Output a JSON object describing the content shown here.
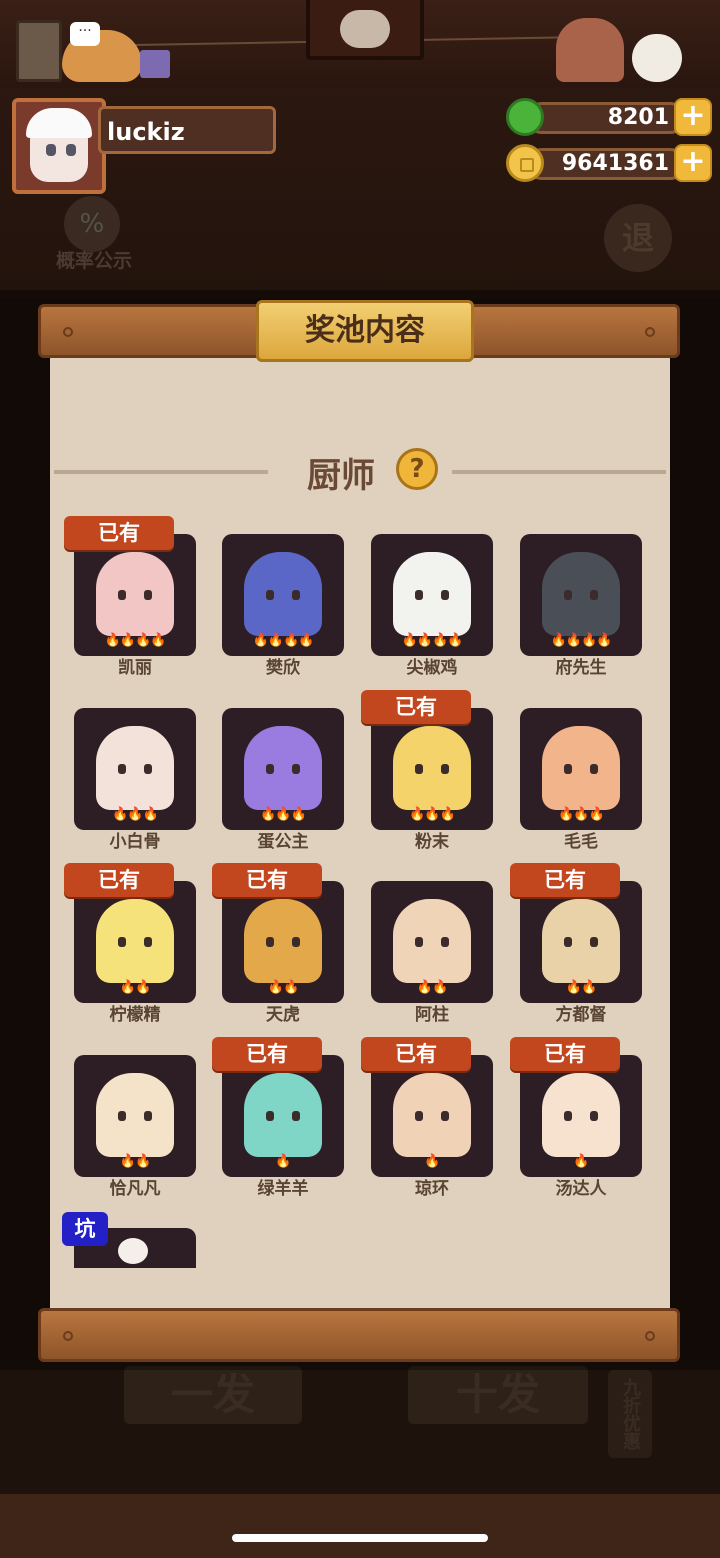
{
  "player": {
    "name": "luckiz"
  },
  "resources": {
    "apples": "8201",
    "coins": "9641361",
    "plus_label": "+"
  },
  "top_buttons": {
    "probability": "概率公示",
    "exit": "退"
  },
  "pool": {
    "title": "奖池内容",
    "section": "厨师",
    "help_label": "?",
    "owned_label": "已有",
    "pit_label": "坑",
    "chefs": [
      {
        "name": "凯丽",
        "owned": true,
        "stars": 4,
        "color": "#f1c6c4"
      },
      {
        "name": "樊欣",
        "owned": false,
        "stars": 4,
        "color": "#5b67c7"
      },
      {
        "name": "尖椒鸡",
        "owned": false,
        "stars": 4,
        "color": "#f2f2ee"
      },
      {
        "name": "府先生",
        "owned": false,
        "stars": 4,
        "color": "#4a4e56"
      },
      {
        "name": "小白骨",
        "owned": false,
        "stars": 3,
        "color": "#f3e2da"
      },
      {
        "name": "蛋公主",
        "owned": false,
        "stars": 3,
        "color": "#9a7be0"
      },
      {
        "name": "粉末",
        "owned": true,
        "stars": 3,
        "color": "#f4d36a"
      },
      {
        "name": "毛毛",
        "owned": false,
        "stars": 3,
        "color": "#f2b48a"
      },
      {
        "name": "柠檬精",
        "owned": true,
        "stars": 2,
        "color": "#f5e27a"
      },
      {
        "name": "天虎",
        "owned": true,
        "stars": 2,
        "color": "#e3a84a"
      },
      {
        "name": "阿柱",
        "owned": false,
        "stars": 2,
        "color": "#f0d4b8"
      },
      {
        "name": "方都督",
        "owned": true,
        "stars": 2,
        "color": "#e9d1a8"
      },
      {
        "name": "恰凡凡",
        "owned": false,
        "stars": 2,
        "color": "#f4e3c8"
      },
      {
        "name": "绿羊羊",
        "owned": true,
        "stars": 1,
        "color": "#7fd6c6"
      },
      {
        "name": "琼环",
        "owned": true,
        "stars": 1,
        "color": "#f0d2b6"
      },
      {
        "name": "汤达人",
        "owned": true,
        "stars": 1,
        "color": "#f6e2cf"
      }
    ]
  },
  "bottom_buttons": {
    "one_draw": "一发",
    "ten_draw": "十发",
    "discount": "九折优惠"
  },
  "colors": {
    "badge": "#c2471e",
    "pit_badge": "#2320c8",
    "card_bg": "#2d1e25",
    "paper": "#dfd1bd",
    "title_gold": "#f2cf73"
  }
}
